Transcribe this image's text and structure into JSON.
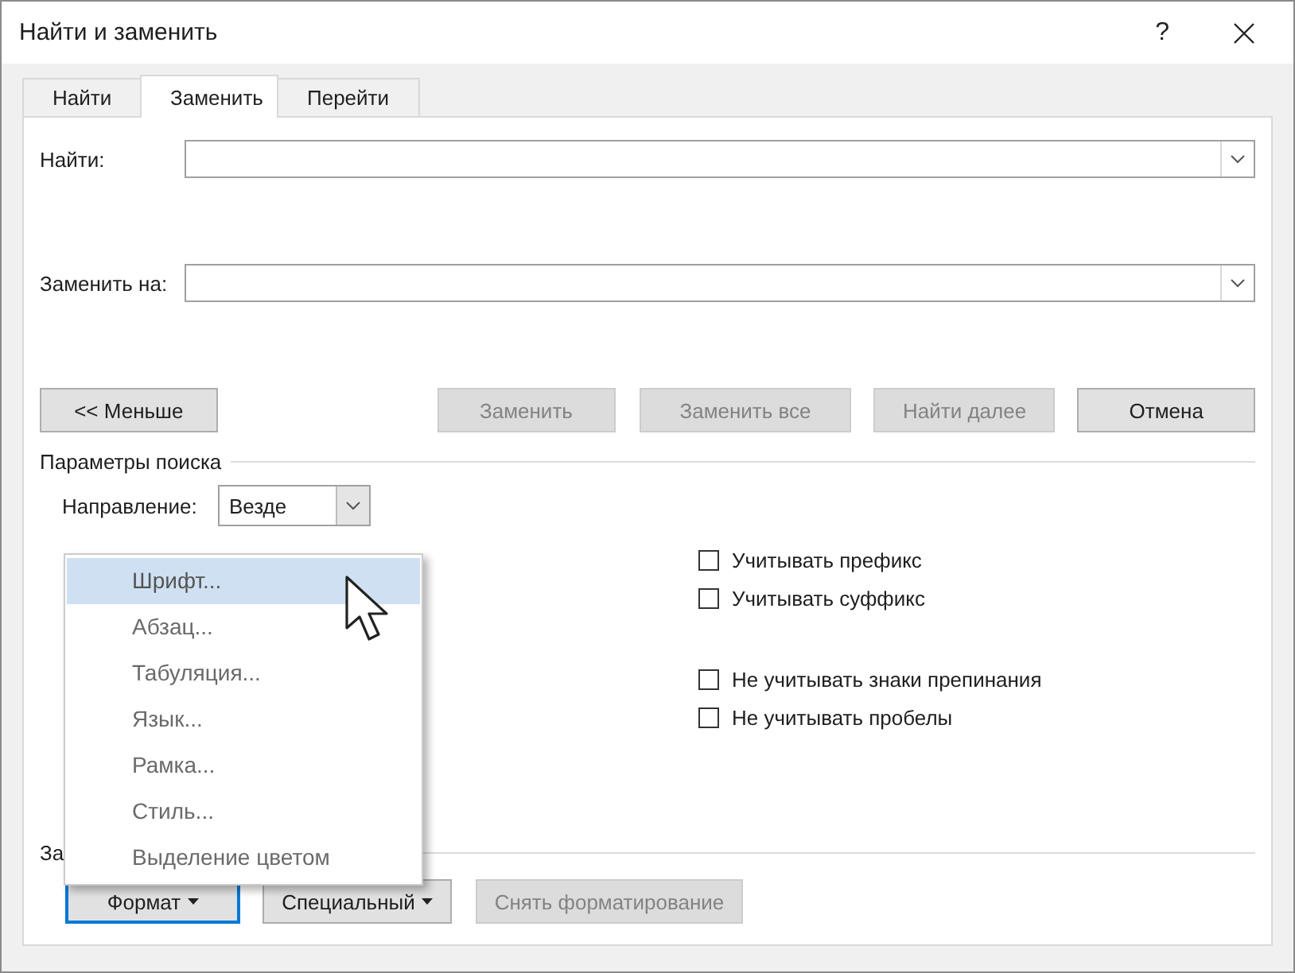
{
  "window": {
    "title": "Найти и заменить",
    "help": "?"
  },
  "tabs": [
    {
      "label": "Найти",
      "selected": false
    },
    {
      "label": "Заменить",
      "selected": true
    },
    {
      "label": "Перейти",
      "selected": false
    }
  ],
  "fields": [
    {
      "label": "Найти:"
    },
    {
      "label": "Заменить на:"
    }
  ],
  "buttons": [
    {
      "label": "<< Меньше",
      "disabled": false
    },
    {
      "label": "Заменить",
      "disabled": true
    },
    {
      "label": "Заменить все",
      "disabled": true
    },
    {
      "label": "Найти далее",
      "disabled": true
    },
    {
      "label": "Отмена",
      "disabled": false
    }
  ],
  "search_options": {
    "title": "Параметры поиска",
    "direction": {
      "label": "Направление:",
      "value": "Везде"
    },
    "right_groups": [
      {
        "items": [
          {
            "label": "Учитывать префикс",
            "checked": false
          },
          {
            "label": "Учитывать суффикс",
            "checked": false
          }
        ]
      },
      {
        "items": [
          {
            "label": "Не учитывать знаки препинания",
            "checked": false
          },
          {
            "label": "Не учитывать пробелы",
            "checked": false
          }
        ]
      }
    ]
  },
  "replace_section": {
    "title": "За"
  },
  "format_buttons": [
    {
      "label": "Формат",
      "dropdown": true,
      "focused": true,
      "disabled": false
    },
    {
      "label": "Специальный",
      "dropdown": true,
      "focused": false,
      "disabled": false
    },
    {
      "label": "Снять форматирование",
      "dropdown": false,
      "focused": false,
      "disabled": true
    }
  ],
  "menu": {
    "items": [
      {
        "label": "Шрифт...",
        "selected": true
      },
      {
        "label": "Абзац...",
        "selected": false
      },
      {
        "label": "Табуляция...",
        "selected": false
      },
      {
        "label": "Язык...",
        "selected": false
      },
      {
        "label": "Рамка...",
        "selected": false
      },
      {
        "label": "Стиль...",
        "selected": false
      },
      {
        "label": "Выделение цветом",
        "selected": false
      }
    ]
  }
}
